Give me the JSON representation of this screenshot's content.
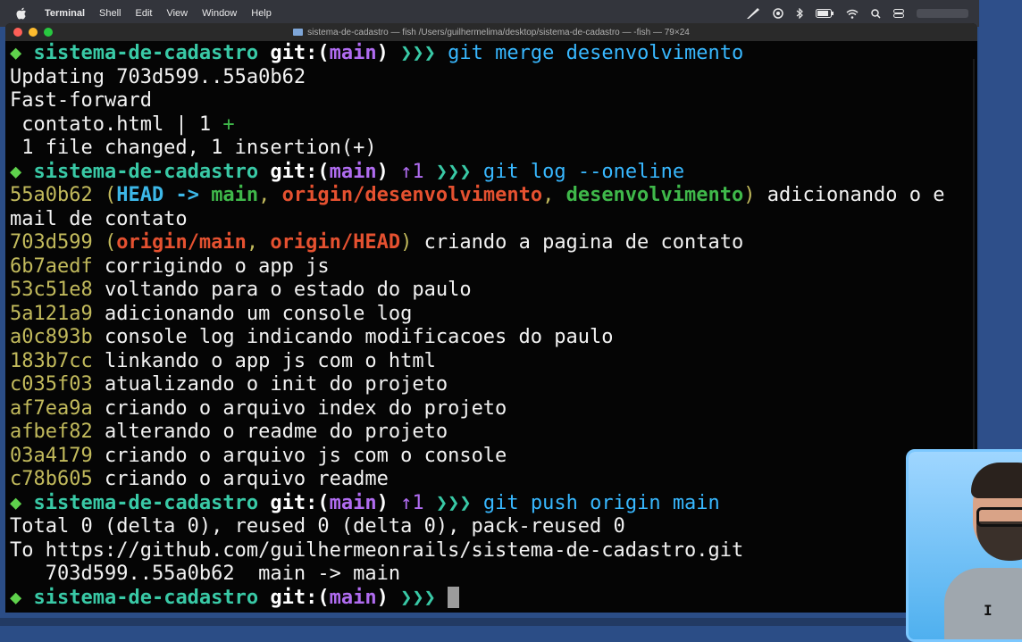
{
  "menubar": {
    "app": "Terminal",
    "items": [
      "Shell",
      "Edit",
      "View",
      "Window",
      "Help"
    ]
  },
  "window": {
    "title": "sistema-de-cadastro — fish /Users/guilhermelima/desktop/sistema-de-cadastro — -fish — 79×24"
  },
  "prompt": {
    "diamond": "◆",
    "dir": "sistema-de-cadastro",
    "git_open": "git:(",
    "branch": "main",
    "git_close": ")",
    "arrows": "❯❯❯",
    "ahead": "↑1"
  },
  "commands": {
    "merge": "git merge desenvolvimento",
    "log": "git log --oneline",
    "push": "git push origin main"
  },
  "merge_output": [
    "Updating 703d599..55a0b62",
    "Fast-forward",
    " contato.html | 1 ",
    " 1 file changed, 1 insertion(+)"
  ],
  "merge_plus": "+",
  "log": {
    "first": {
      "hash": "55a0b62",
      "open": " (",
      "head": "HEAD -> ",
      "head_branch": "main",
      "sep1": ", ",
      "remote_dev": "origin/desenvolvimento",
      "sep2": ", ",
      "local_dev": "desenvolvimento",
      "close": ")",
      "message": " adicionando o e",
      "message_wrap": "mail de contato"
    },
    "second": {
      "hash": "703d599",
      "open": " (",
      "remote_main": "origin/main",
      "sep": ", ",
      "remote_head": "origin/HEAD",
      "close": ")",
      "message": " criando a pagina de contato"
    },
    "entries": [
      {
        "hash": "6b7aedf",
        "message": " corrigindo o app js"
      },
      {
        "hash": "53c51e8",
        "message": " voltando para o estado do paulo"
      },
      {
        "hash": "5a121a9",
        "message": " adicionando um console log"
      },
      {
        "hash": "a0c893b",
        "message": " console log indicando modificacoes do paulo"
      },
      {
        "hash": "183b7cc",
        "message": " linkando o app js com o html"
      },
      {
        "hash": "c035f03",
        "message": " atualizando o init do projeto"
      },
      {
        "hash": "af7ea9a",
        "message": " criando o arquivo index do projeto"
      },
      {
        "hash": "afbef82",
        "message": " alterando o readme do projeto"
      },
      {
        "hash": "03a4179",
        "message": " criando o arquivo js com o console"
      },
      {
        "hash": "c78b605",
        "message": " criando o arquivo readme"
      }
    ]
  },
  "push_output": [
    "Total 0 (delta 0), reused 0 (delta 0), pack-reused 0",
    "To https://github.com/guilhermeonrails/sistema-de-cadastro.git",
    "   703d599..55a0b62  main -> main"
  ],
  "webcam": {
    "shirt_text": "I"
  },
  "colors": {
    "terminal_bg": "#050505",
    "prompt_dir": "#39c9a6",
    "branch": "#b06cf0",
    "command": "#38b8ff",
    "hash": "#c2ba5c",
    "remote_ref": "#e55130",
    "local_ref": "#3fb84a"
  }
}
